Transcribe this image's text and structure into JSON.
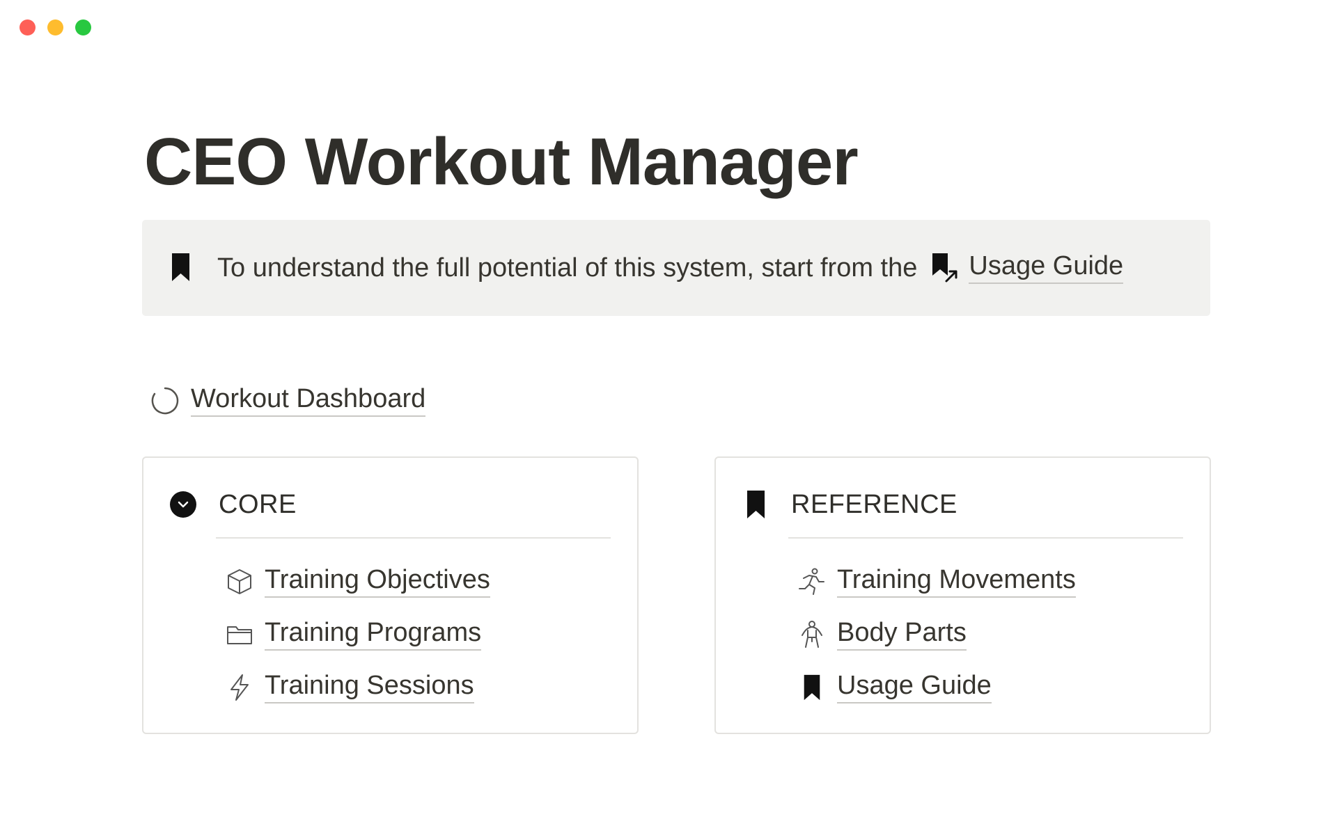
{
  "window": {
    "controls": [
      "close",
      "minimize",
      "zoom"
    ]
  },
  "page": {
    "title": "CEO Workout Manager"
  },
  "callout": {
    "icon": "bookmark-icon",
    "text": "To understand the full potential of this system, start from the",
    "link_label": "Usage Guide",
    "link_icon": "bookmark-link-icon"
  },
  "dashboard_link": {
    "icon": "loading-circle-icon",
    "label": "Workout Dashboard"
  },
  "cards": {
    "core": {
      "title": "CORE",
      "icon": "chevron-down-circle-icon",
      "items": [
        {
          "label": "Training Objectives",
          "icon": "cube-icon"
        },
        {
          "label": "Training Programs",
          "icon": "folder-icon"
        },
        {
          "label": "Training Sessions",
          "icon": "lightning-icon"
        }
      ]
    },
    "reference": {
      "title": "REFERENCE",
      "icon": "bookmark-icon",
      "items": [
        {
          "label": "Training Movements",
          "icon": "running-person-icon"
        },
        {
          "label": "Body Parts",
          "icon": "body-icon"
        },
        {
          "label": "Usage Guide",
          "icon": "bookmark-icon"
        }
      ]
    }
  },
  "colors": {
    "text": "#37352f",
    "callout_bg": "#f1f1ef",
    "border": "#e3e2df",
    "close": "#fe5f57",
    "minimize": "#febc2e",
    "zoom": "#28c840"
  }
}
